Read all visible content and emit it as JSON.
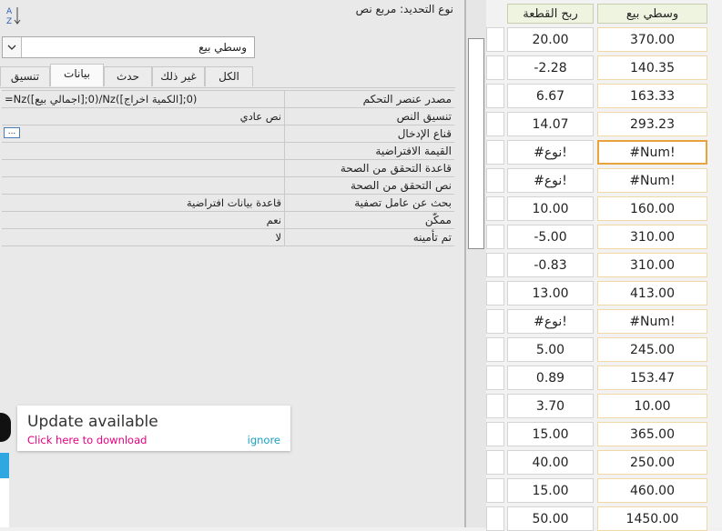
{
  "prop_sheet": {
    "selection_label": "نوع التحديد:",
    "selection_value": "مربع نص",
    "object_value": "وسطي بيع",
    "tabs": [
      {
        "label": "تنسيق",
        "active": false
      },
      {
        "label": "بيانات",
        "active": true
      },
      {
        "label": "حدث",
        "active": false
      },
      {
        "label": "غير ذلك",
        "active": false
      },
      {
        "label": "الكل",
        "active": false
      }
    ],
    "rows": [
      {
        "label": "مصدر عنصر التحكم",
        "value": "=Nz([اجمالي بيع];0)/Nz([الكمية اخراج];0)",
        "ltr": true
      },
      {
        "label": "تنسيق النص",
        "value": "نص عادي"
      },
      {
        "label": "قناع الإدخال",
        "value": "",
        "builder": true
      },
      {
        "label": "القيمة الافتراضية",
        "value": ""
      },
      {
        "label": "قاعدة التحقق من الصحة",
        "value": ""
      },
      {
        "label": "نص التحقق من الصحة",
        "value": ""
      },
      {
        "label": "بحث عن عامل تصفية",
        "value": "قاعدة بيانات افتراضية"
      },
      {
        "label": "ممكّن",
        "value": "نعم"
      },
      {
        "label": "تم تأمينه",
        "value": "لا"
      }
    ],
    "builder_label": "..."
  },
  "toast": {
    "title": "Update available",
    "link": "Click here to download",
    "ignore": "ignore"
  },
  "datasheet": {
    "headers": {
      "avg": "وسطي بيع",
      "profit": "ربح القطعة"
    },
    "rows": [
      {
        "avg": "370.00",
        "profit": "20.00"
      },
      {
        "avg": "140.35",
        "profit": "-2.28"
      },
      {
        "avg": "163.33",
        "profit": "6.67"
      },
      {
        "avg": "293.23",
        "profit": "14.07"
      },
      {
        "avg": "#Num!",
        "profit": "#نوع!",
        "active": true
      },
      {
        "avg": "#Num!",
        "profit": "#نوع!"
      },
      {
        "avg": "160.00",
        "profit": "10.00"
      },
      {
        "avg": "310.00",
        "profit": "-5.00"
      },
      {
        "avg": "310.00",
        "profit": "-0.83"
      },
      {
        "avg": "413.00",
        "profit": "13.00"
      },
      {
        "avg": "#Num!",
        "profit": "#نوع!"
      },
      {
        "avg": "245.00",
        "profit": "5.00"
      },
      {
        "avg": "153.47",
        "profit": "0.89"
      },
      {
        "avg": "10.00",
        "profit": "3.70"
      },
      {
        "avg": "365.00",
        "profit": "15.00"
      },
      {
        "avg": "250.00",
        "profit": "40.00"
      },
      {
        "avg": "460.00",
        "profit": "15.00"
      },
      {
        "avg": "1450.00",
        "profit": "50.00"
      }
    ]
  },
  "colors": {
    "active_cell_border": "#e8a33a",
    "toast_link": "#e6007e",
    "toast_ignore": "#1aa0c4"
  }
}
